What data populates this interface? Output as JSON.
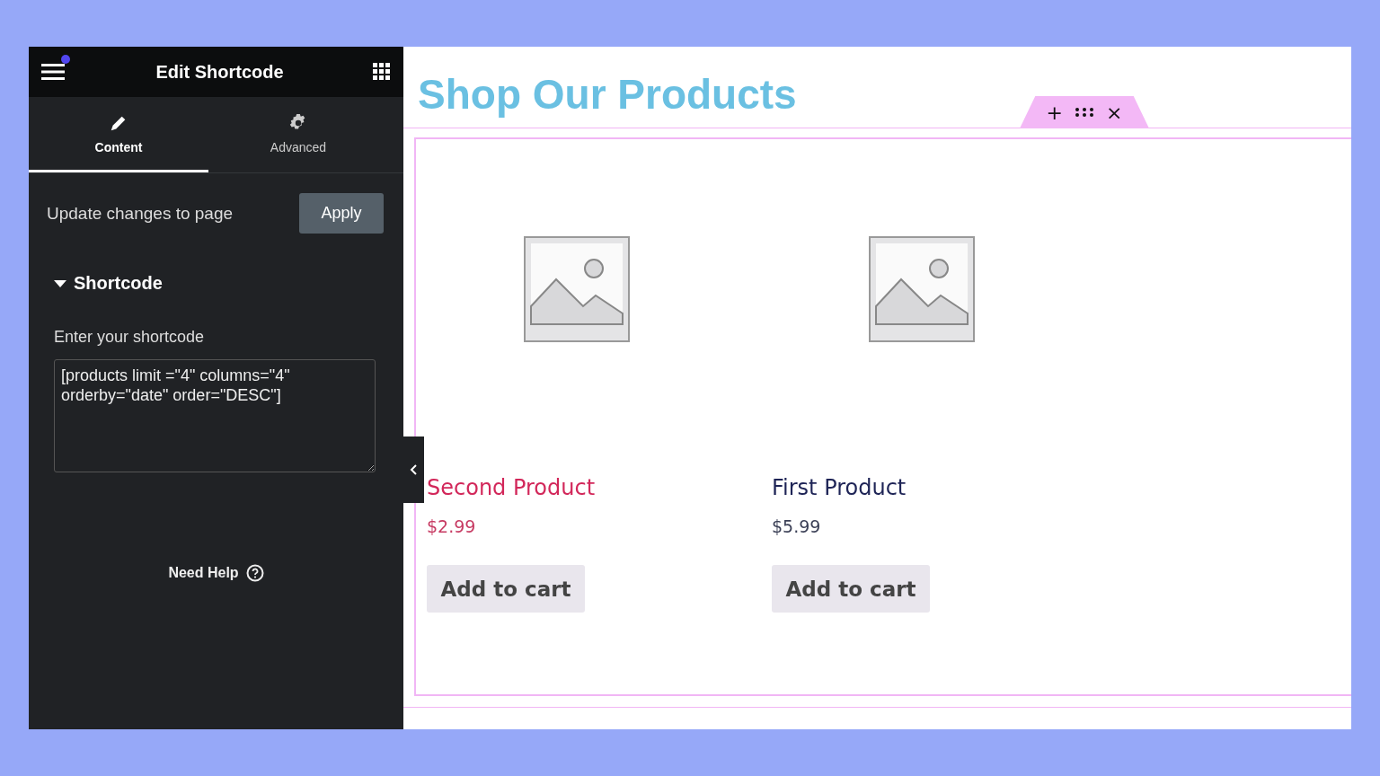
{
  "panel": {
    "title": "Edit Shortcode",
    "notification": true,
    "tabs": [
      {
        "label": "Content",
        "selected": true
      },
      {
        "label": "Advanced",
        "selected": false
      }
    ],
    "update": {
      "text": "Update changes to page",
      "button": "Apply"
    },
    "section": {
      "title": "Shortcode",
      "expanded": true,
      "field_label": "Enter your shortcode",
      "value": "[products limit =\"4\" columns=\"4\" orderby=\"date\" order=\"DESC\"]"
    },
    "help": "Need Help"
  },
  "preview": {
    "heading": "Shop Our Products",
    "toolbar": [
      "+",
      "×"
    ],
    "products": [
      {
        "name": "Second Product",
        "price": "$2.99",
        "button": "Add to cart",
        "highlighted": true
      },
      {
        "name": "First Product",
        "price": "$5.99",
        "button": "Add to cart",
        "highlighted": false
      }
    ]
  }
}
